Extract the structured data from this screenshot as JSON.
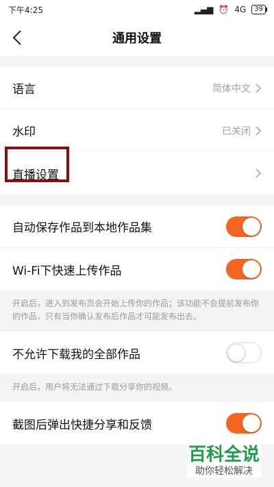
{
  "status": {
    "time": "下午4:25",
    "network": "4G",
    "battery": "39"
  },
  "header": {
    "title": "通用设置"
  },
  "sections": {
    "lang": {
      "label": "语言",
      "value": "简体中文"
    },
    "watermark": {
      "label": "水印",
      "value": "已关闭"
    },
    "live": {
      "label": "直播设置"
    },
    "autosave": {
      "label": "自动保存作品到本地作品集",
      "state": "on"
    },
    "wifi_upload": {
      "label": "Wi-Fi下快速上传作品",
      "state": "on"
    },
    "wifi_note": "开启后，进入到发布页会开始上传你的作品；该功能不会提前发布你的作品，只有当你确认发布后作品才可能发布出去。",
    "no_download": {
      "label": "不允许下载我的全部作品",
      "state": "off"
    },
    "download_note": "开启后，用户将无法通过下载分享你的视频。",
    "screenshot": {
      "label": "截图后弹出快捷分享和反馈",
      "state": "on"
    }
  },
  "watermark_logo": {
    "main": "百科全说",
    "sub": "助你轻松解决"
  },
  "colors": {
    "accent": "#f26522",
    "highlight": "#8b0e0e"
  }
}
